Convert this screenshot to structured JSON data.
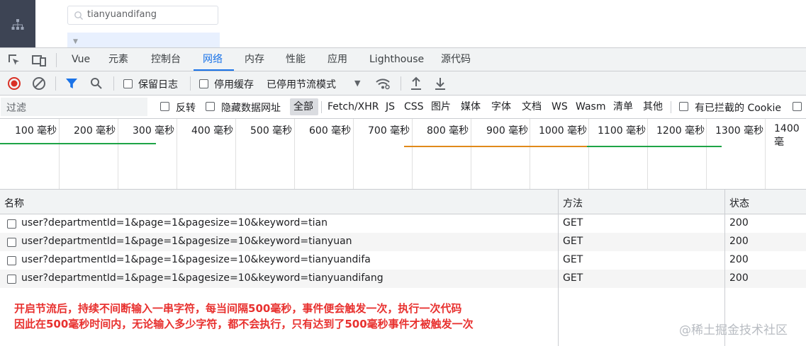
{
  "app": {
    "search_value": "tianyuandifang"
  },
  "devtools": {
    "tabs": [
      "Vue",
      "元素",
      "控制台",
      "网络",
      "内存",
      "性能",
      "应用",
      "Lighthouse",
      "源代码"
    ],
    "active_tab": "网络"
  },
  "toolbar": {
    "preserve_log": "保留日志",
    "disable_cache": "停用缓存",
    "throttle": "已停用节流模式"
  },
  "filter": {
    "placeholder": "过滤",
    "invert": "反转",
    "hide_data_urls": "隐藏数据网址",
    "types": [
      "全部",
      "Fetch/XHR",
      "JS",
      "CSS",
      "图片",
      "媒体",
      "字体",
      "文档",
      "WS",
      "Wasm",
      "清单",
      "其他"
    ],
    "blocked_cookies": "有已拦截的 Cookie"
  },
  "timeline": {
    "labels": [
      "100 毫秒",
      "200 毫秒",
      "300 毫秒",
      "400 毫秒",
      "500 毫秒",
      "600 毫秒",
      "700 毫秒",
      "800 毫秒",
      "900 毫秒",
      "1000 毫秒",
      "1100 毫秒",
      "1200 毫秒",
      "1300 毫秒",
      "1400 毫"
    ],
    "colors": {
      "green": "#1ea446",
      "orange": "#e08a1a"
    }
  },
  "table": {
    "headers": {
      "name": "名称",
      "method": "方法",
      "status": "状态"
    },
    "rows": [
      {
        "name": "user?departmentId=1&page=1&pagesize=10&keyword=tian",
        "method": "GET",
        "status": "200"
      },
      {
        "name": "user?departmentId=1&page=1&pagesize=10&keyword=tianyuan",
        "method": "GET",
        "status": "200"
      },
      {
        "name": "user?departmentId=1&page=1&pagesize=10&keyword=tianyuandifa",
        "method": "GET",
        "status": "200"
      },
      {
        "name": "user?departmentId=1&page=1&pagesize=10&keyword=tianyuandifang",
        "method": "GET",
        "status": "200"
      }
    ]
  },
  "annotation": {
    "line1": "开启节流后，持续不间断输入一串字符，每当间隔500毫秒，事件便会触发一次，执行一次代码",
    "line2": "因此在500毫秒时间内，无论输入多少字符，都不会执行，只有达到了500毫秒事件才被触发一次",
    "color": "#e8312f"
  },
  "watermark": "@稀土掘金技术社区"
}
